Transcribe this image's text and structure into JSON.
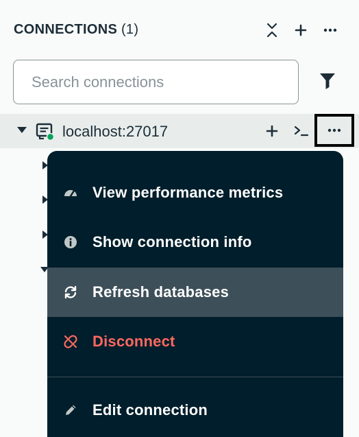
{
  "header": {
    "title": "CONNECTIONS",
    "count": "(1)",
    "icons": [
      "collapse-icon",
      "plus-icon",
      "ellipsis-icon"
    ]
  },
  "search": {
    "placeholder": "Search connections",
    "value": ""
  },
  "connection": {
    "name": "localhost:27017",
    "status_color": "#00a35c",
    "actions": [
      "plus-icon",
      "shell-icon",
      "ellipsis-icon"
    ]
  },
  "menu": {
    "items": [
      {
        "label": "View performance metrics",
        "icon": "gauge-icon"
      },
      {
        "label": "Show connection info",
        "icon": "info-icon"
      },
      {
        "label": "Refresh databases",
        "icon": "refresh-icon"
      },
      {
        "label": "Disconnect",
        "icon": "disconnect-icon"
      },
      {
        "label": "Edit connection",
        "icon": "pencil-icon"
      }
    ]
  },
  "colors": {
    "menu_background": "#001e2b",
    "menu_highlight": "#3d4f58",
    "danger": "#ff6960",
    "row_background": "#e8edeb"
  }
}
